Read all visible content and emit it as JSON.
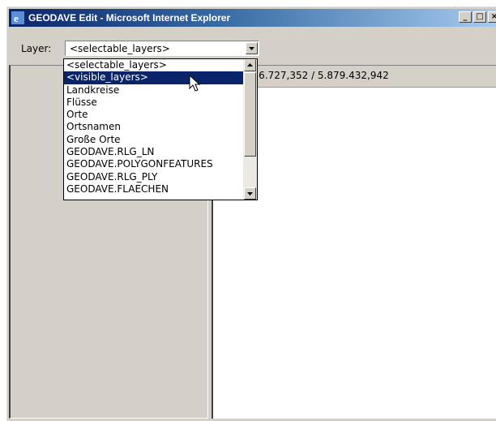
{
  "window": {
    "title": "GEODAVE Edit - Microsoft Internet Explorer",
    "controls": [
      "minimize-icon",
      "maximize-icon",
      "close-icon"
    ]
  },
  "toolbar": {
    "layer_label": "Layer:",
    "layer_select_value": "<selectable_layers>"
  },
  "dropdown": {
    "options": [
      "<selectable_layers>",
      "<visible_layers>",
      "Landkreise",
      "Flüsse",
      "Orte",
      "Ortsnamen",
      "Große Orte",
      "GEODAVE.RLG_LN",
      "GEODAVE.POLYGONFEATURES",
      "GEODAVE.RLG_PLY",
      "GEODAVE.FLAECHEN"
    ],
    "highlighted_index": 1
  },
  "status": {
    "coordinates": "n: 3.536.727,352 / 5.879.432,942"
  },
  "colors": {
    "title_gradient_start": "#0a246a",
    "title_gradient_end": "#a6caf0",
    "selection": "#0a246a",
    "face": "#d4d0c8"
  }
}
